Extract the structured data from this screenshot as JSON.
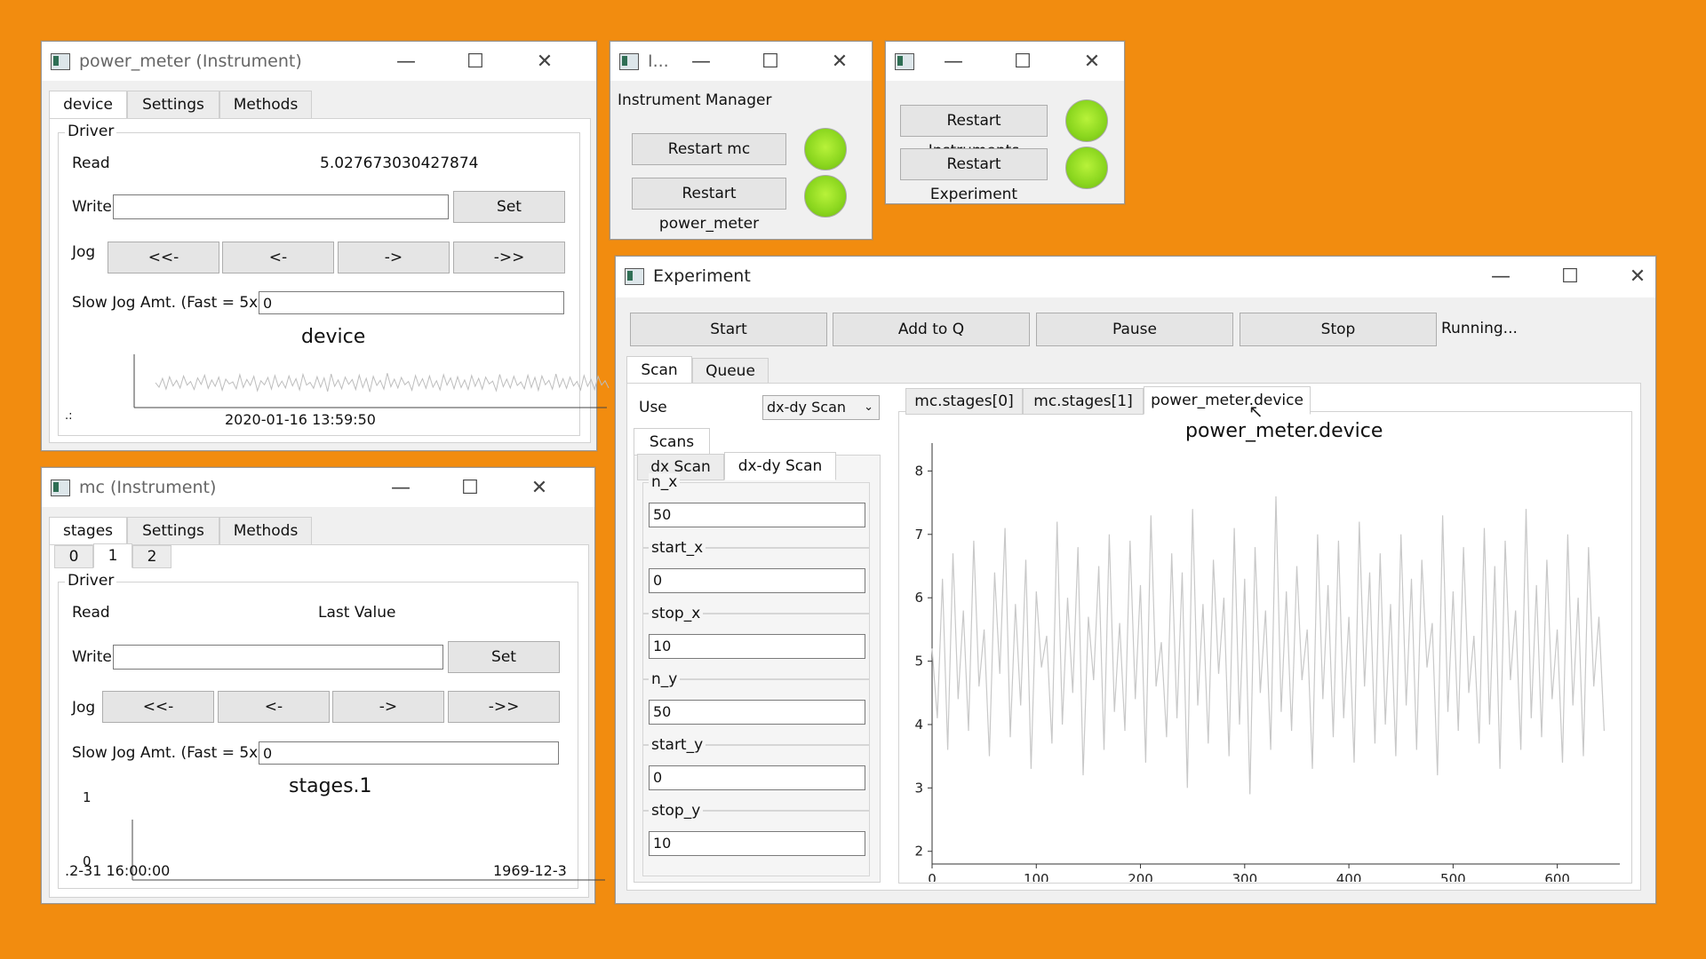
{
  "power_meter_window": {
    "title": "power_meter (Instrument)",
    "tabs": [
      "device",
      "Settings",
      "Methods"
    ],
    "group_title": "Driver",
    "read_label": "Read",
    "read_value": "5.027673030427874",
    "write_label": "Write",
    "write_value": "",
    "set_label": "Set",
    "jog_label": "Jog",
    "jog_buttons": [
      "<<-",
      "<-",
      "->",
      "->>"
    ],
    "slow_jog_label": "Slow Jog Amt. (Fast = 5x)",
    "slow_jog_value": "0",
    "plot_title": "device",
    "plot_x_label": "2020-01-16 13:59:50",
    "plot_corner": ".:"
  },
  "mc_window": {
    "title": "mc (Instrument)",
    "tabs": [
      "stages",
      "Settings",
      "Methods"
    ],
    "subtabs": [
      "0",
      "1",
      "2"
    ],
    "group_title": "Driver",
    "read_label": "Read",
    "read_value": "Last Value",
    "write_label": "Write",
    "write_value": "",
    "set_label": "Set",
    "jog_label": "Jog",
    "jog_buttons": [
      "<<-",
      "<-",
      "->",
      "->>"
    ],
    "slow_jog_label": "Slow Jog Amt. (Fast = 5x)",
    "slow_jog_value": "0",
    "plot_title": "stages.1",
    "y_top": "1",
    "y_bottom": "0",
    "x_left": ".2-31 16:00:00",
    "x_right": "1969-12-3"
  },
  "im_window": {
    "title": "I...",
    "heading": "Instrument Manager",
    "buttons": [
      "Restart mc",
      "Restart power_meter"
    ]
  },
  "restart_window": {
    "buttons": [
      "Restart Instruments",
      "Restart Experiment"
    ]
  },
  "experiment_window": {
    "title": "Experiment",
    "toolbar": [
      "Start",
      "Add to Q",
      "Pause",
      "Stop"
    ],
    "status": "Running...",
    "left_tabs": [
      "Scan",
      "Queue"
    ],
    "use_label": "Use",
    "use_value": "dx-dy Scan",
    "scans_label": "Scans",
    "scan_tabs": [
      "dx Scan",
      "dx-dy Scan"
    ],
    "fields": [
      {
        "label": "n_x",
        "value": "50"
      },
      {
        "label": "start_x",
        "value": "0"
      },
      {
        "label": "stop_x",
        "value": "10"
      },
      {
        "label": "n_y",
        "value": "50"
      },
      {
        "label": "start_y",
        "value": "0"
      },
      {
        "label": "stop_y",
        "value": "10"
      }
    ],
    "plot_tabs": [
      "mc.stages[0]",
      "mc.stages[1]",
      "power_meter.device"
    ]
  },
  "chart_data": {
    "type": "line",
    "title": "power_meter.device",
    "xlabel": "",
    "ylabel": "",
    "xlim": [
      0,
      660
    ],
    "ylim": [
      1.8,
      8.3
    ],
    "x_ticks": [
      0,
      100,
      200,
      300,
      400,
      500,
      600
    ],
    "y_ticks": [
      2,
      3,
      4,
      5,
      6,
      7,
      8
    ],
    "series": [
      {
        "color": "#c8c8c8",
        "x_step": 5,
        "values": [
          5.2,
          4.1,
          6.3,
          3.6,
          6.7,
          4.4,
          5.8,
          3.9,
          6.9,
          4.6,
          5.5,
          3.5,
          6.4,
          4.8,
          7.1,
          3.8,
          5.9,
          4.3,
          6.6,
          3.3,
          6.1,
          4.9,
          5.4,
          3.7,
          7.2,
          4.0,
          6.0,
          4.5,
          6.8,
          3.2,
          5.7,
          4.7,
          6.5,
          3.6,
          7.0,
          4.2,
          5.6,
          3.9,
          6.9,
          4.4,
          6.2,
          3.4,
          7.3,
          4.6,
          5.3,
          3.8,
          6.7,
          4.1,
          6.4,
          3.0,
          7.4,
          4.3,
          5.9,
          3.7,
          6.6,
          4.8,
          6.0,
          3.5,
          7.1,
          4.0,
          6.3,
          2.9,
          6.8,
          4.5,
          5.8,
          3.6,
          7.6,
          4.2,
          6.1,
          3.9,
          6.5,
          4.7,
          5.5,
          3.3,
          7.0,
          4.4,
          6.2,
          3.8,
          6.9,
          4.1,
          5.7,
          3.4,
          7.2,
          4.6,
          6.4,
          3.7,
          6.7,
          4.0,
          5.9,
          3.5,
          7.0,
          4.3,
          6.3,
          3.6,
          6.6,
          4.9,
          5.6,
          3.2,
          7.3,
          4.2,
          6.1,
          3.9,
          6.8,
          4.5,
          5.4,
          3.7,
          7.1,
          4.0,
          6.5,
          3.3,
          6.9,
          4.7,
          5.8,
          3.6,
          7.4,
          4.1,
          6.2,
          3.8,
          6.6,
          4.4,
          5.5,
          3.4,
          7.0,
          4.3,
          6.0,
          3.5,
          6.8,
          4.6,
          5.7,
          3.9
        ]
      }
    ]
  }
}
